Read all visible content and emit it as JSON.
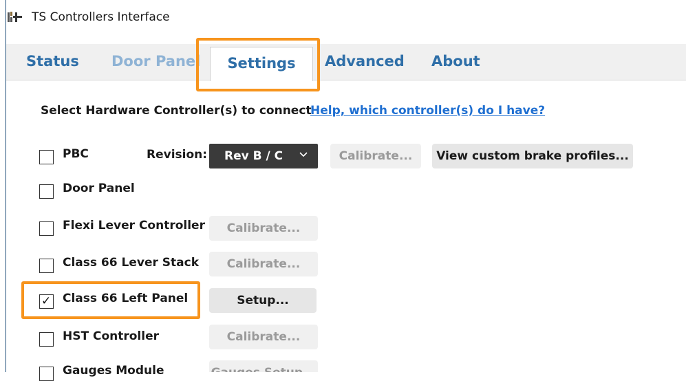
{
  "window": {
    "title": "TS Controllers Interface"
  },
  "tabs": [
    {
      "label": "Status",
      "state": "enabled"
    },
    {
      "label": "Door Panel",
      "state": "disabled"
    },
    {
      "label": "Settings",
      "state": "active"
    },
    {
      "label": "Advanced",
      "state": "enabled"
    },
    {
      "label": "About",
      "state": "enabled"
    }
  ],
  "settings": {
    "heading": "Select Hardware Controller(s) to connect",
    "help_link": "Help, which controller(s) do I have?",
    "revision_label": "Revision:",
    "revision_value": "Rev B / C",
    "brake_profiles_button": "View custom brake profiles...",
    "controllers": [
      {
        "label": "PBC",
        "checked": false,
        "button": "Calibrate...",
        "button_enabled": false
      },
      {
        "label": "Door Panel",
        "checked": false
      },
      {
        "label": "Flexi Lever Controller",
        "checked": false,
        "button": "Calibrate...",
        "button_enabled": false
      },
      {
        "label": "Class 66 Lever Stack",
        "checked": false,
        "button": "Calibrate...",
        "button_enabled": false
      },
      {
        "label": "Class 66 Left Panel",
        "checked": true,
        "button": "Setup...",
        "button_enabled": true
      },
      {
        "label": "HST Controller",
        "checked": false,
        "button": "Calibrate...",
        "button_enabled": false
      },
      {
        "label": "Gauges Module",
        "checked": false,
        "button": "Gauges Setup...",
        "button_enabled": false
      }
    ]
  },
  "colors": {
    "highlight": "#f7941d",
    "tab_text": "#2f6fa8",
    "link": "#1f6fd1"
  }
}
